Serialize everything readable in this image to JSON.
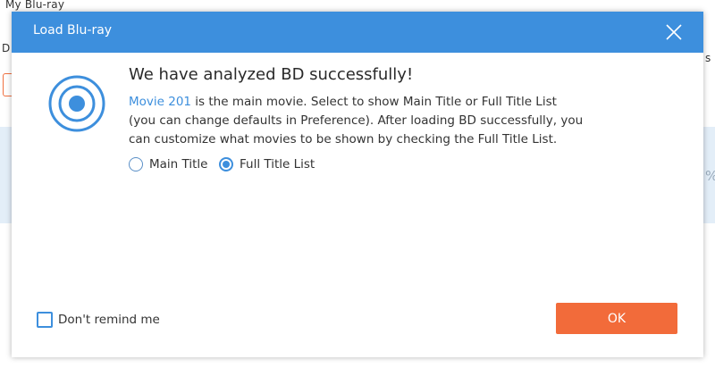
{
  "background_app": {
    "title": "My Blu-ray",
    "left_letter": "D",
    "right_letter": "s",
    "right_glyph": "%"
  },
  "dialog": {
    "title": "Load Blu-ray",
    "headline": "We have analyzed BD successfully!",
    "movie_link": "Movie 201",
    "description_line1_rest": " is the main movie. Select to show Main Title or Full Title List",
    "description_line2": "(you can change defaults in Preference). After loading BD successfully, you",
    "description_line3": "can customize what movies to be shown by checking the Full Title List.",
    "options": [
      {
        "label": "Main Title",
        "selected": false
      },
      {
        "label": "Full Title List",
        "selected": true
      }
    ],
    "dont_remind_label": "Don't remind me",
    "dont_remind_checked": false,
    "ok_label": "OK"
  },
  "colors": {
    "accent": "#3d8fdd",
    "ok_button": "#f26b3a"
  },
  "icons": {
    "close": "close-icon",
    "disc": "disc-icon"
  }
}
